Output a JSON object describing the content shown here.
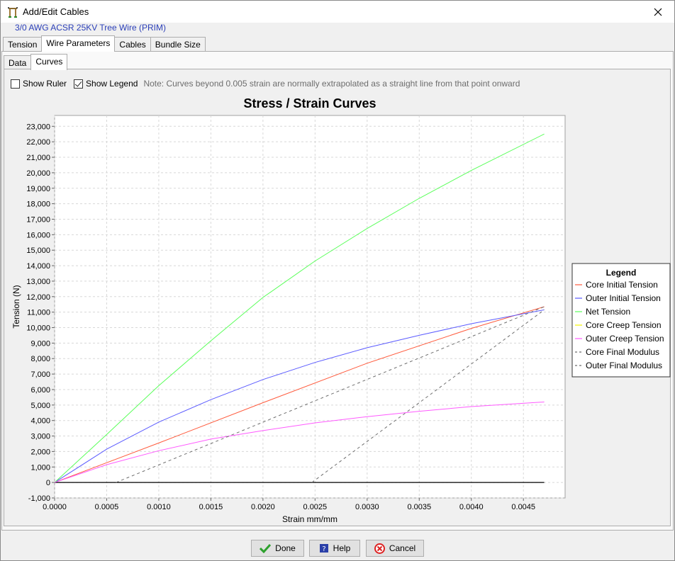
{
  "window": {
    "title": "Add/Edit Cables",
    "subtitle": "3/0 AWG ACSR 25KV Tree Wire (PRIM)"
  },
  "tabs": [
    "Tension",
    "Wire Parameters",
    "Cables",
    "Bundle Size"
  ],
  "active_tab": "Wire Parameters",
  "subtabs": [
    "Data",
    "Curves"
  ],
  "active_subtab": "Curves",
  "options": {
    "show_ruler": {
      "label": "Show Ruler",
      "checked": false
    },
    "show_legend": {
      "label": "Show Legend",
      "checked": true
    },
    "note": "Note: Curves beyond 0.005 strain are normally extrapolated as a straight line from that point onward"
  },
  "buttons": {
    "done": "Done",
    "help": "Help",
    "cancel": "Cancel"
  },
  "chart_data": {
    "type": "line",
    "title": "Stress / Strain Curves",
    "xlabel": "Strain mm/mm",
    "ylabel": "Tension (N)",
    "xlim": [
      0,
      0.0049
    ],
    "ylim": [
      -1000,
      23700
    ],
    "x_ticks": [
      "0.0000",
      "0.0005",
      "0.0010",
      "0.0015",
      "0.0020",
      "0.0025",
      "0.0030",
      "0.0035",
      "0.0040",
      "0.0045"
    ],
    "y_ticks": [
      "-1,000",
      "0",
      "1,000",
      "2,000",
      "3,000",
      "4,000",
      "5,000",
      "6,000",
      "7,000",
      "8,000",
      "9,000",
      "10,000",
      "11,000",
      "12,000",
      "13,000",
      "14,000",
      "15,000",
      "16,000",
      "17,000",
      "18,000",
      "19,000",
      "20,000",
      "21,000",
      "22,000",
      "23,000"
    ],
    "grid": true,
    "legend_title": "Legend",
    "legend_position": "right",
    "series": [
      {
        "name": "Core Initial Tension",
        "color": "#ff5a3c",
        "dash": false,
        "x": [
          0,
          0.001,
          0.002,
          0.003,
          0.004,
          0.0047
        ],
        "y": [
          0,
          2550,
          5150,
          7700,
          9950,
          11350
        ]
      },
      {
        "name": "Outer Initial Tension",
        "color": "#5a5aff",
        "dash": false,
        "x": [
          0,
          0.0005,
          0.001,
          0.0015,
          0.002,
          0.0025,
          0.003,
          0.0035,
          0.004,
          0.0047
        ],
        "y": [
          0,
          2150,
          3900,
          5350,
          6650,
          7750,
          8700,
          9500,
          10250,
          11150
        ]
      },
      {
        "name": "Net Tension",
        "color": "#5aff5a",
        "dash": false,
        "x": [
          0,
          0.0005,
          0.001,
          0.0015,
          0.002,
          0.0025,
          0.003,
          0.0035,
          0.004,
          0.0047
        ],
        "y": [
          0,
          3100,
          6250,
          9150,
          11950,
          14300,
          16400,
          18350,
          20150,
          22500
        ]
      },
      {
        "name": "Core Creep Tension",
        "color": "#f2f200",
        "dash": false,
        "x": [
          0,
          0.0047
        ],
        "y": [
          0,
          0
        ]
      },
      {
        "name": "Outer Creep Tension",
        "color": "#ff5aff",
        "dash": false,
        "x": [
          0,
          0.0005,
          0.001,
          0.0015,
          0.002,
          0.0025,
          0.003,
          0.0035,
          0.004,
          0.0047
        ],
        "y": [
          0,
          1150,
          2050,
          2800,
          3350,
          3850,
          4250,
          4600,
          4900,
          5200
        ]
      },
      {
        "name": "Core Final Modulus",
        "color": "#6e6e6e",
        "dash": true,
        "x": [
          0.00059,
          0.0047
        ],
        "y": [
          0,
          11350
        ]
      },
      {
        "name": "Outer Final Modulus",
        "color": "#6e6e6e",
        "dash": true,
        "x": [
          0.00247,
          0.0047
        ],
        "y": [
          0,
          11150
        ]
      }
    ]
  }
}
